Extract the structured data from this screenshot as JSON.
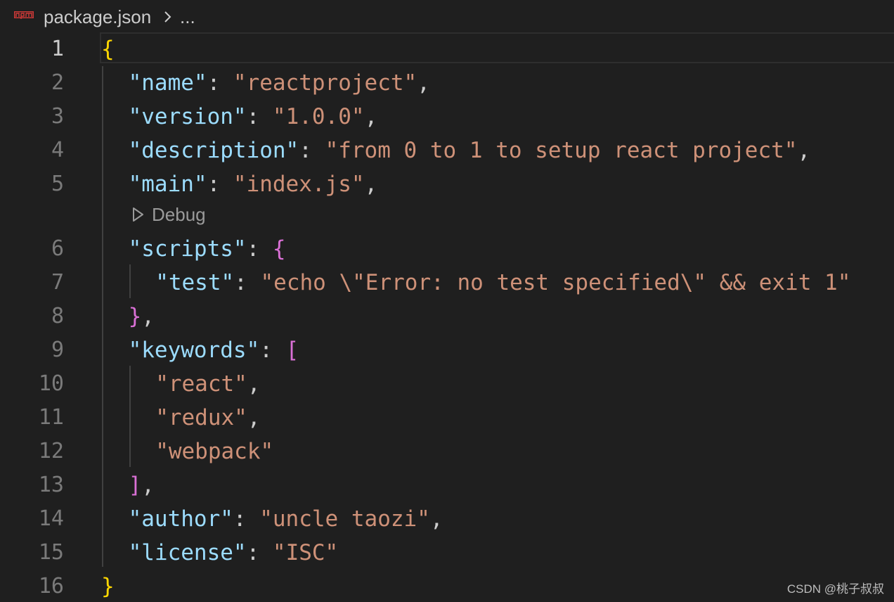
{
  "breadcrumb": {
    "icon": "npm-icon",
    "file": "package.json",
    "more": "..."
  },
  "codelens": {
    "label": "Debug",
    "icon": "play-outline-icon"
  },
  "colors": {
    "background": "#1f1f1f",
    "key": "#9cdcfe",
    "string": "#ce9178",
    "punctuation": "#cccccc",
    "bracket_level_1": "#ffd700",
    "bracket_level_2": "#da70d6",
    "line_number": "#7a7a7a",
    "line_number_active": "#cccccc"
  },
  "lines": [
    {
      "num": "1",
      "active": true,
      "indent": 0,
      "tokens": [
        {
          "t": "{",
          "c": "b1"
        }
      ]
    },
    {
      "num": "2",
      "indent": 1,
      "tokens": [
        {
          "t": "\"name\"",
          "c": "k"
        },
        {
          "t": ": ",
          "c": "p"
        },
        {
          "t": "\"reactproject\"",
          "c": "s"
        },
        {
          "t": ",",
          "c": "p"
        }
      ]
    },
    {
      "num": "3",
      "indent": 1,
      "tokens": [
        {
          "t": "\"version\"",
          "c": "k"
        },
        {
          "t": ": ",
          "c": "p"
        },
        {
          "t": "\"1.0.0\"",
          "c": "s"
        },
        {
          "t": ",",
          "c": "p"
        }
      ]
    },
    {
      "num": "4",
      "indent": 1,
      "tokens": [
        {
          "t": "\"description\"",
          "c": "k"
        },
        {
          "t": ": ",
          "c": "p"
        },
        {
          "t": "\"from 0 to 1 to setup react project\"",
          "c": "s"
        },
        {
          "t": ",",
          "c": "p"
        }
      ]
    },
    {
      "num": "5",
      "indent": 1,
      "tokens": [
        {
          "t": "\"main\"",
          "c": "k"
        },
        {
          "t": ": ",
          "c": "p"
        },
        {
          "t": "\"index.js\"",
          "c": "s"
        },
        {
          "t": ",",
          "c": "p"
        }
      ]
    },
    {
      "num": "6",
      "indent": 1,
      "tokens": [
        {
          "t": "\"scripts\"",
          "c": "k"
        },
        {
          "t": ": ",
          "c": "p"
        },
        {
          "t": "{",
          "c": "b2"
        }
      ]
    },
    {
      "num": "7",
      "indent": 2,
      "tokens": [
        {
          "t": "\"test\"",
          "c": "k"
        },
        {
          "t": ": ",
          "c": "p"
        },
        {
          "t": "\"echo \\\"Error: no test specified\\\" && exit 1\"",
          "c": "s"
        }
      ]
    },
    {
      "num": "8",
      "indent": 1,
      "tokens": [
        {
          "t": "}",
          "c": "b2"
        },
        {
          "t": ",",
          "c": "p"
        }
      ]
    },
    {
      "num": "9",
      "indent": 1,
      "tokens": [
        {
          "t": "\"keywords\"",
          "c": "k"
        },
        {
          "t": ": ",
          "c": "p"
        },
        {
          "t": "[",
          "c": "b2"
        }
      ]
    },
    {
      "num": "10",
      "indent": 2,
      "tokens": [
        {
          "t": "\"react\"",
          "c": "s"
        },
        {
          "t": ",",
          "c": "p"
        }
      ]
    },
    {
      "num": "11",
      "indent": 2,
      "tokens": [
        {
          "t": "\"redux\"",
          "c": "s"
        },
        {
          "t": ",",
          "c": "p"
        }
      ]
    },
    {
      "num": "12",
      "indent": 2,
      "tokens": [
        {
          "t": "\"webpack\"",
          "c": "s"
        }
      ]
    },
    {
      "num": "13",
      "indent": 1,
      "tokens": [
        {
          "t": "]",
          "c": "b2"
        },
        {
          "t": ",",
          "c": "p"
        }
      ]
    },
    {
      "num": "14",
      "indent": 1,
      "tokens": [
        {
          "t": "\"author\"",
          "c": "k"
        },
        {
          "t": ": ",
          "c": "p"
        },
        {
          "t": "\"uncle taozi\"",
          "c": "s"
        },
        {
          "t": ",",
          "c": "p"
        }
      ]
    },
    {
      "num": "15",
      "indent": 1,
      "tokens": [
        {
          "t": "\"license\"",
          "c": "k"
        },
        {
          "t": ": ",
          "c": "p"
        },
        {
          "t": "\"ISC\"",
          "c": "s"
        }
      ]
    },
    {
      "num": "16",
      "indent": 0,
      "tokens": [
        {
          "t": "}",
          "c": "b1"
        }
      ]
    }
  ],
  "watermark": "CSDN @桃子叔叔"
}
